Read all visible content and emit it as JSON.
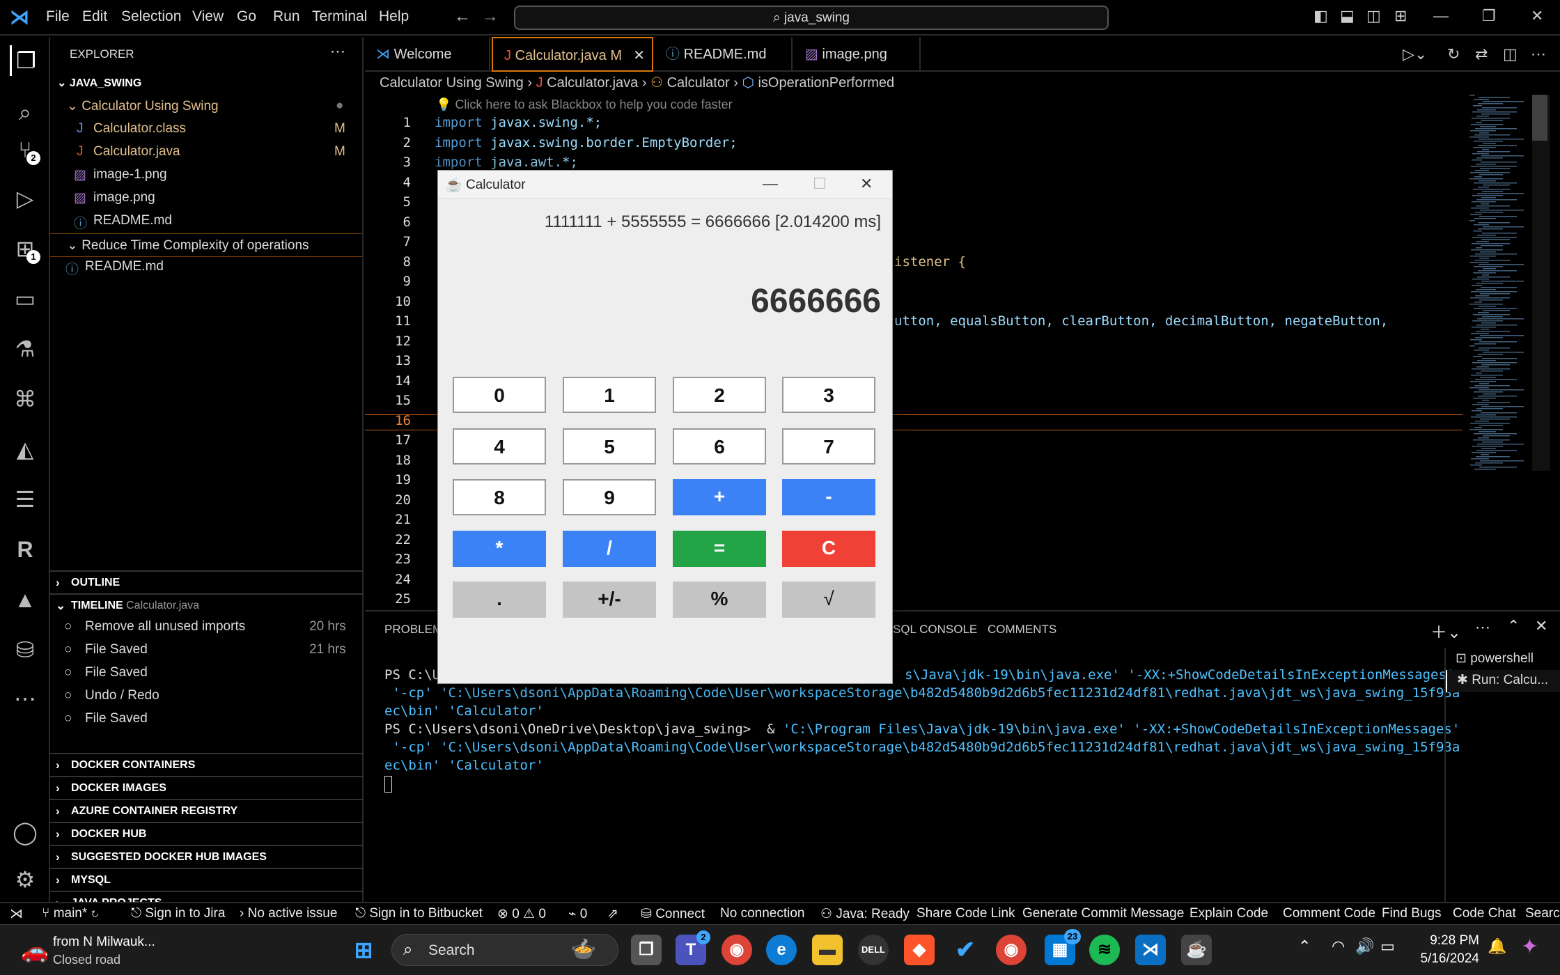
{
  "menu": [
    "File",
    "Edit",
    "Selection",
    "View",
    "Go",
    "Run",
    "Terminal",
    "Help"
  ],
  "search": {
    "text": "java_swing"
  },
  "activity_badges": {
    "scm": "2",
    "extensions": "1"
  },
  "explorer": {
    "title": "EXPLORER",
    "root": "JAVA_SWING",
    "folder1": "Calculator Using Swing",
    "files": [
      {
        "name": "Calculator.class",
        "status": "M"
      },
      {
        "name": "Calculator.java",
        "status": "M"
      },
      {
        "name": "image-1.png",
        "status": ""
      },
      {
        "name": "image.png",
        "status": ""
      },
      {
        "name": "README.md",
        "status": ""
      }
    ],
    "folder2": "Reduce Time Complexity of operations",
    "folder2_file": "README.md"
  },
  "outline": "OUTLINE",
  "timeline": {
    "title": "TIMELINE",
    "file": "Calculator.java",
    "items": [
      {
        "label": "Remove all unused imports",
        "time": "20 hrs"
      },
      {
        "label": "File Saved",
        "time": "21 hrs"
      },
      {
        "label": "File Saved",
        "time": ""
      },
      {
        "label": "Undo / Redo",
        "time": ""
      },
      {
        "label": "File Saved",
        "time": ""
      }
    ]
  },
  "sections": [
    "DOCKER CONTAINERS",
    "DOCKER IMAGES",
    "AZURE CONTAINER REGISTRY",
    "DOCKER HUB",
    "SUGGESTED DOCKER HUB IMAGES",
    "MYSQL",
    "JAVA PROJECTS"
  ],
  "tabs": [
    {
      "label": "Welcome"
    },
    {
      "label": "Calculator.java",
      "mod": "M"
    },
    {
      "label": "README.md"
    },
    {
      "label": "image.png"
    }
  ],
  "breadcrumb": {
    "folder": "Calculator Using Swing",
    "file": "Calculator.java",
    "class": "Calculator",
    "member": "isOperationPerformed"
  },
  "hint": "Click here to ask Blackbox to help you code faster",
  "line_numbers": [
    "1",
    "2",
    "3",
    "4",
    "5",
    "6",
    "7",
    "8",
    "9",
    "10",
    "11",
    "12",
    "13",
    "14",
    "15",
    "16",
    "17",
    "18",
    "19",
    "20",
    "21",
    "22",
    "23",
    "24",
    "25"
  ],
  "code": {
    "l1_kw": "import",
    "l1_rest": " javax.swing.*;",
    "l2_kw": "import",
    "l2_rest": " javax.swing.border.EmptyBorder;",
    "l3_kw": "import",
    "l3_rest": " java.awt.*;",
    "l8_tail": "istener {",
    "l11_tail": "utton, equalsButton, clearButton, decimalButton, negateButton,"
  },
  "panel_tabs": {
    "problems": "PROBLEMS",
    "sql": "SQL CONSOLE",
    "comments": "COMMENTS"
  },
  "terminal_list": [
    "powershell",
    "Run: Calcu..."
  ],
  "terminal": {
    "l1a": "PS C:\\U",
    "l1b": "s\\Java\\jdk-19\\bin\\java.exe' '-XX:+ShowCodeDetailsInExceptionMessages'",
    "l2": " '-cp' 'C:\\Users\\dsoni\\AppData\\Roaming\\Code\\User\\workspaceStorage\\b482d5480b9d2d6b5fec11231d24df81\\redhat.java\\jdt_ws\\java_swing_15f93a",
    "l3": "ec\\bin' 'Calculator'",
    "l4a": "PS C:\\Users\\dsoni\\OneDrive\\Desktop\\java_swing>  & ",
    "l4b": "'C:\\Program Files\\Java\\jdk-19\\bin\\java.exe' '-XX:+ShowCodeDetailsInExceptionMessages'",
    "l5": " '-cp' 'C:\\Users\\dsoni\\AppData\\Roaming\\Code\\User\\workspaceStorage\\b482d5480b9d2d6b5fec11231d24df81\\redhat.java\\jdt_ws\\java_swing_15f93a",
    "l6": "ec\\bin' 'Calculator'"
  },
  "status": {
    "branch": "main*",
    "jira": "Sign in to Jira",
    "issue": "No active issue",
    "bitbucket": "Sign in to Bitbucket",
    "errors": "0",
    "warnings": "0",
    "ports": "0",
    "connect": "Connect",
    "noconn": "No connection",
    "java": "Java: Ready",
    "share": "Share Code Link",
    "commit": "Generate Commit Message",
    "explain": "Explain Code",
    "comment": "Comment Code",
    "bugs": "Find Bugs",
    "chat": "Code Chat",
    "search": "Search"
  },
  "calculator": {
    "title": "Calculator",
    "history": "1111111 + 5555555 = 6666666 [2.014200 ms]",
    "display": "6666666",
    "buttons": [
      "0",
      "1",
      "2",
      "3",
      "4",
      "5",
      "6",
      "7",
      "8",
      "9",
      "+",
      "-",
      "*",
      "/",
      "=",
      "C",
      ".",
      "+/-",
      "%",
      "√"
    ]
  },
  "taskbar": {
    "weather_title": "from N Milwauk...",
    "weather_sub": "Closed road",
    "search": "Search",
    "teams_badge": "2",
    "store_badge": "23",
    "time": "9:28 PM",
    "date": "5/16/2024"
  }
}
